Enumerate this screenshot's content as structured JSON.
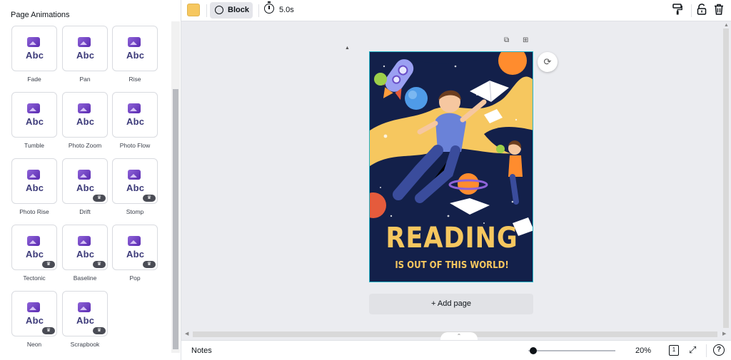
{
  "panel": {
    "title": "Page Animations",
    "animations": [
      {
        "label": "Fade",
        "premium": false
      },
      {
        "label": "Pan",
        "premium": false
      },
      {
        "label": "Rise",
        "premium": false
      },
      {
        "label": "Tumble",
        "premium": false
      },
      {
        "label": "Photo Zoom",
        "premium": false
      },
      {
        "label": "Photo Flow",
        "premium": false
      },
      {
        "label": "Photo Rise",
        "premium": false
      },
      {
        "label": "Drift",
        "premium": true
      },
      {
        "label": "Stomp",
        "premium": true
      },
      {
        "label": "Tectonic",
        "premium": true
      },
      {
        "label": "Baseline",
        "premium": true
      },
      {
        "label": "Pop",
        "premium": true
      },
      {
        "label": "Neon",
        "premium": true
      },
      {
        "label": "Scrapbook",
        "premium": true
      }
    ],
    "thumb_text": "Abc"
  },
  "toolbar": {
    "color": "#f6c75f",
    "block_label": "Block",
    "duration": "5.0s",
    "icons": [
      "paint-roller-icon",
      "unlock-icon",
      "trash-icon"
    ]
  },
  "design": {
    "headline": "READING",
    "subline": "IS OUT OF THIS WORLD!",
    "background_colors": [
      "#f6c75f",
      "#13204a"
    ]
  },
  "canvas": {
    "add_page_label": "+ Add page"
  },
  "bottom": {
    "notes_label": "Notes",
    "zoom_level": 20,
    "zoom_label": "20%",
    "page_count": "1",
    "help_label": "?"
  }
}
